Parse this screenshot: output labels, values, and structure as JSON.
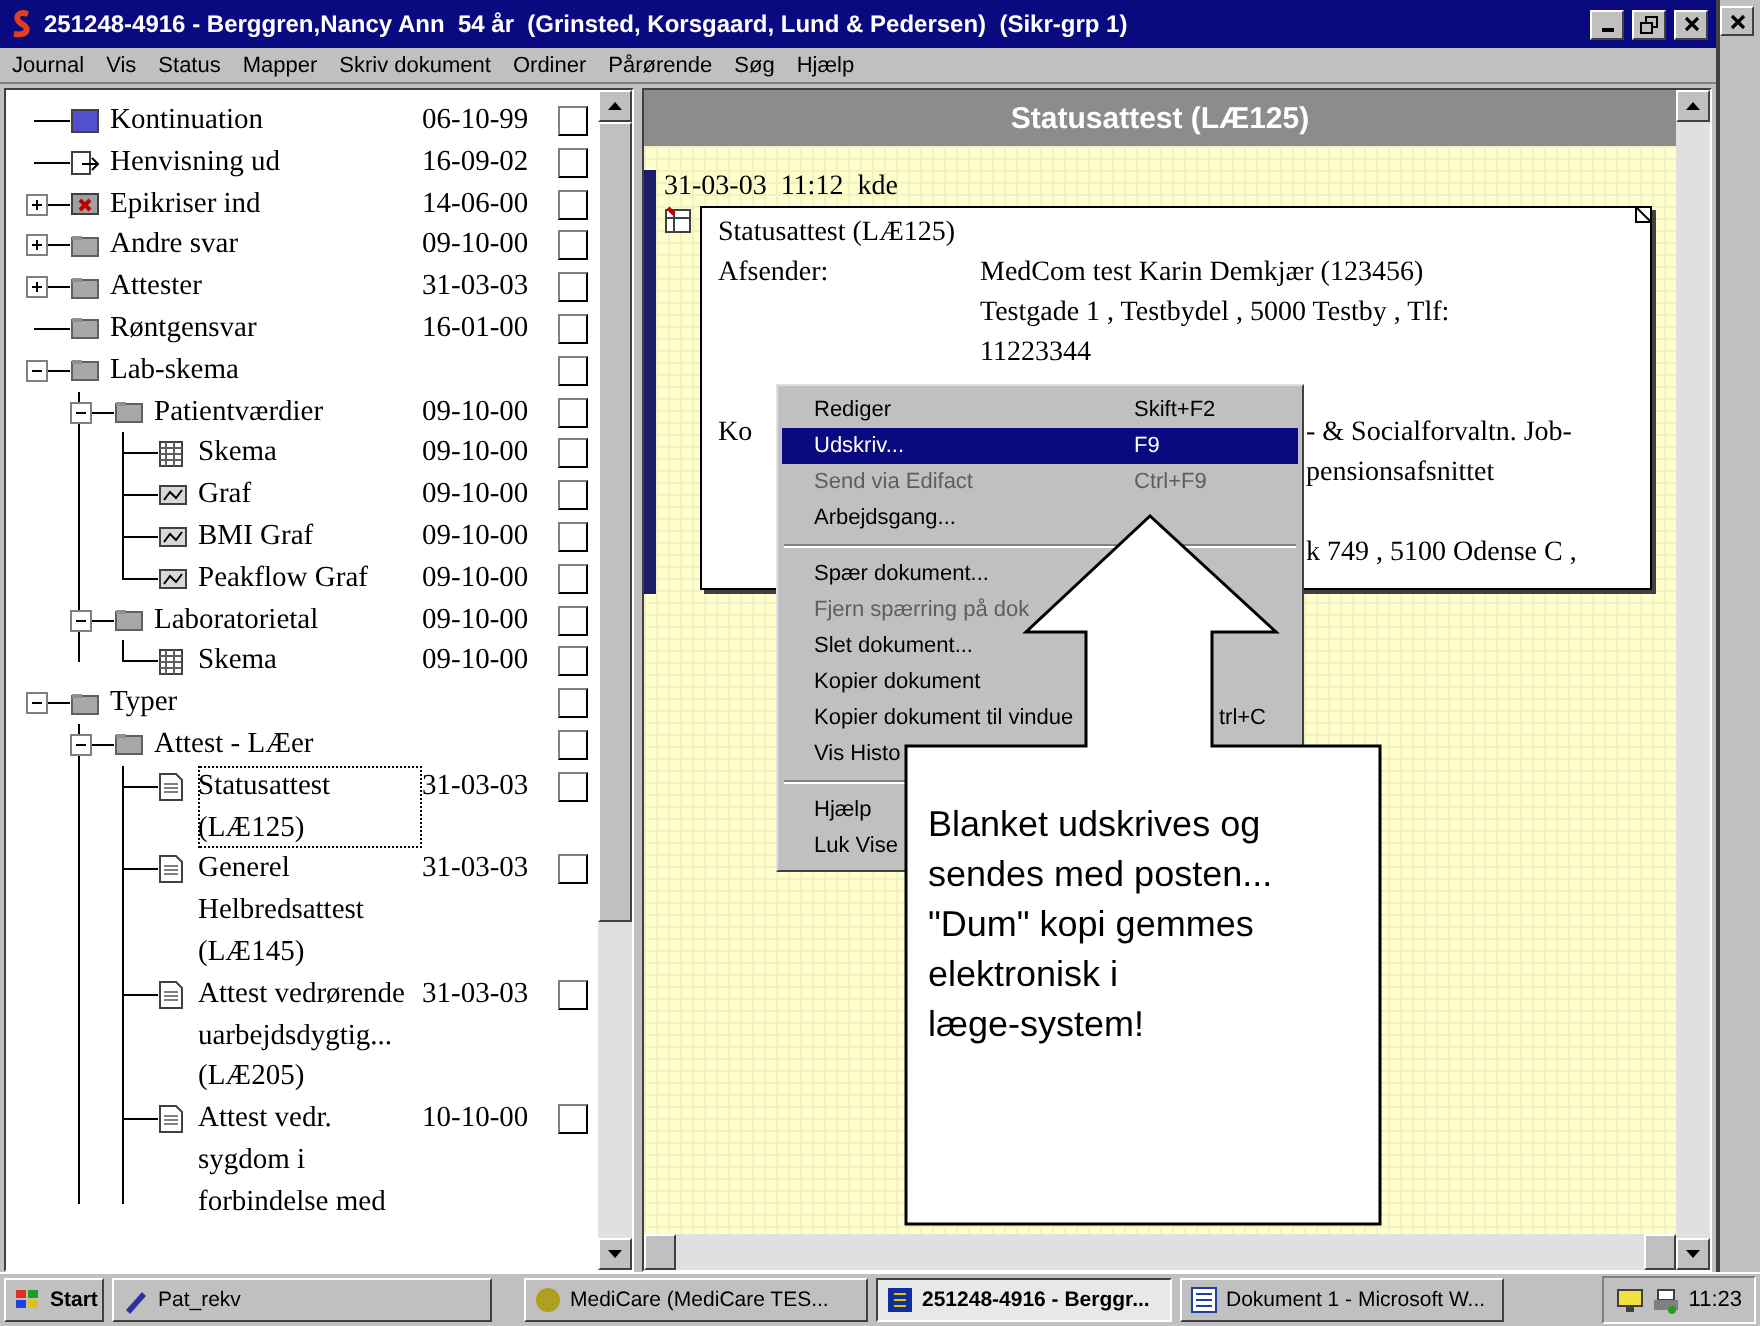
{
  "window": {
    "title": "251248-4916 - Berggren,Nancy Ann  54 år  (Grinsted, Korsgaard, Lund & Pedersen)  (Sikr-grp 1)"
  },
  "menu_bar": [
    "Journal",
    "Vis",
    "Status",
    "Mapper",
    "Skriv dokument",
    "Ordiner",
    "Pårørende",
    "Søg",
    "Hjælp"
  ],
  "tree": [
    {
      "label": "Kontinuation",
      "date": "06-10-99",
      "kind": "note",
      "checked": false,
      "selected": false
    },
    {
      "label": "Henvisning ud",
      "date": "16-09-02",
      "kind": "referral",
      "checked": false,
      "selected": false
    },
    {
      "label": "Epikriser ind",
      "date": "14-06-00",
      "kind": "discharge",
      "expanded": false,
      "checked": false,
      "selected": false
    },
    {
      "label": "Andre svar",
      "date": "09-10-00",
      "kind": "folder",
      "expanded": false,
      "checked": false,
      "selected": false
    },
    {
      "label": "Attester",
      "date": "31-03-03",
      "kind": "folder",
      "expanded": false,
      "checked": false,
      "selected": false
    },
    {
      "label": "Røntgensvar",
      "date": "16-01-00",
      "kind": "folder",
      "checked": false,
      "selected": false
    },
    {
      "label": "Lab-skema",
      "kind": "folder",
      "expanded": true,
      "checked": false,
      "selected": false,
      "children": [
        {
          "label": "Patientværdier",
          "date": "09-10-00",
          "kind": "folder",
          "expanded": true,
          "checked": false,
          "selected": false,
          "children": [
            {
              "label": "Skema",
              "date": "09-10-00",
              "kind": "table",
              "checked": false,
              "selected": false
            },
            {
              "label": "Graf",
              "date": "09-10-00",
              "kind": "chart",
              "checked": false,
              "selected": false
            },
            {
              "label": "BMI Graf",
              "date": "09-10-00",
              "kind": "chart",
              "checked": false,
              "selected": false
            },
            {
              "label": "Peakflow Graf",
              "date": "09-10-00",
              "kind": "chart",
              "checked": false,
              "selected": false
            }
          ]
        },
        {
          "label": "Laboratorietal",
          "date": "09-10-00",
          "kind": "folder",
          "expanded": true,
          "checked": false,
          "selected": false,
          "children": [
            {
              "label": "Skema",
              "date": "09-10-00",
              "kind": "table",
              "checked": false,
              "selected": false
            }
          ]
        }
      ]
    },
    {
      "label": "Typer",
      "kind": "folder",
      "expanded": true,
      "checked": false,
      "selected": false,
      "children": [
        {
          "label": "Attest - LÆer",
          "kind": "folder",
          "expanded": true,
          "checked": false,
          "selected": false,
          "children": [
            {
              "label": "Statusattest (LÆ125)",
              "date": "31-03-03",
              "kind": "document",
              "checked": false,
              "selected": true
            },
            {
              "label": "Generel Helbredsattest (LÆ145)",
              "date": "31-03-03",
              "kind": "document",
              "checked": false,
              "selected": false
            },
            {
              "label": "Attest vedrørende uarbejdsdygtig... (LÆ205)",
              "date": "31-03-03",
              "kind": "document",
              "checked": false,
              "selected": false
            },
            {
              "label": "Attest vedr. sygdom i forbindelse med",
              "date": "10-10-00",
              "kind": "document",
              "checked": false,
              "selected": false
            }
          ]
        }
      ]
    }
  ],
  "document_pane": {
    "title": "Statusattest (LÆ125)",
    "entry_header": "31-03-03  11:12  kde",
    "card": {
      "title": "Statusattest (LÆ125)",
      "rows": [
        {
          "label": "Afsender:",
          "lines": [
            "MedCom test Karin Demkjær (123456)",
            "Testgade 1 , Testbydel , 5000 Testby , Tlf:",
            "11223344"
          ]
        },
        {
          "label": "Ko",
          "fragments": [
            "- & Socialforvaltn. Job-",
            "pensionsafsnittet"
          ]
        },
        {
          "fragments": [
            "k 749 , 5100 Odense C ,"
          ]
        }
      ]
    }
  },
  "context_menu": [
    {
      "kind": "item",
      "label": "Rediger",
      "shortcut": "Skift+F2",
      "disabled": false,
      "selected": false
    },
    {
      "kind": "item",
      "label": "Udskriv...",
      "shortcut": "F9",
      "disabled": false,
      "selected": true
    },
    {
      "kind": "item",
      "label": "Send via Edifact",
      "shortcut": "Ctrl+F9",
      "disabled": true,
      "selected": false
    },
    {
      "kind": "item",
      "label": "Arbejdsgang...",
      "disabled": false,
      "selected": false
    },
    {
      "kind": "separator"
    },
    {
      "kind": "item",
      "label": "Spær dokument...",
      "disabled": false,
      "selected": false
    },
    {
      "kind": "item",
      "label": "Fjern spærring på dok",
      "disabled": true,
      "selected": false
    },
    {
      "kind": "item",
      "label": "Slet dokument...",
      "disabled": false,
      "selected": false
    },
    {
      "kind": "item",
      "label": "Kopier dokument",
      "disabled": false,
      "selected": false
    },
    {
      "kind": "item",
      "label": "Kopier dokument til vindue",
      "shortcut": "trl+C",
      "disabled": false,
      "selected": false
    },
    {
      "kind": "item",
      "label": "Vis Histo",
      "disabled": false,
      "selected": false
    },
    {
      "kind": "separator"
    },
    {
      "kind": "item",
      "label": "Hjælp",
      "disabled": false,
      "selected": false
    },
    {
      "kind": "item",
      "label": "Luk Vise",
      "disabled": false,
      "selected": false
    }
  ],
  "callout": {
    "text": "Blanket udskrives og\nsendes med posten...\n\"Dum\" kopi gemmes\nelektronisk  i\nlæge-system!"
  },
  "taskbar": {
    "start": "Start",
    "buttons": [
      {
        "label": "Pat_rekv",
        "kind": "pen",
        "active": false
      },
      {
        "label": "MediCare  (MediCare TES...",
        "kind": "medicare",
        "active": false
      },
      {
        "label": "251248-4916 - Berggr...",
        "kind": "app",
        "active": true
      },
      {
        "label": "Dokument 1 - Microsoft W...",
        "kind": "word",
        "active": false
      }
    ],
    "clock": "11:23"
  }
}
